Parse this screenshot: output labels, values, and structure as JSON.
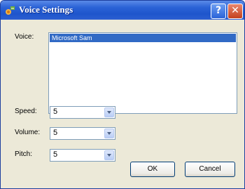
{
  "window": {
    "title": "Voice Settings"
  },
  "titlebar": {
    "help_glyph": "?",
    "close_glyph": "✕",
    "icon": "voice-settings-icon"
  },
  "voice": {
    "label": "Voice:",
    "items": [
      "Microsoft Sam"
    ],
    "selected": "Microsoft Sam"
  },
  "speed": {
    "label": "Speed:",
    "value": "5"
  },
  "volume": {
    "label": "Volume:",
    "value": "5"
  },
  "pitch": {
    "label": "Pitch:",
    "value": "5"
  },
  "buttons": {
    "ok": "OK",
    "cancel": "Cancel"
  },
  "colors": {
    "titlebar": "#2b63d6",
    "selection": "#316ac5",
    "face": "#ece9d8"
  }
}
